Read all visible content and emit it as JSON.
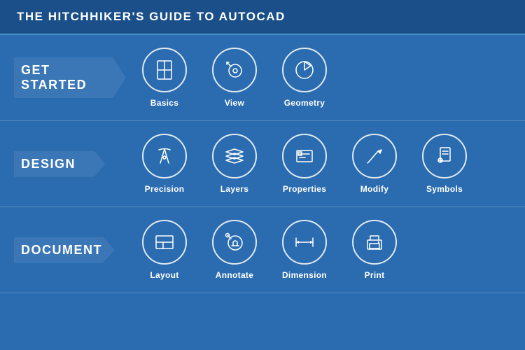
{
  "header": {
    "title": "THE HITCHHIKER'S GUIDE TO AUTOCAD"
  },
  "sections": [
    {
      "id": "get-started",
      "label": "GET STARTED",
      "items": [
        {
          "id": "basics",
          "label": "Basics",
          "icon": "basics"
        },
        {
          "id": "view",
          "label": "View",
          "icon": "view"
        },
        {
          "id": "geometry",
          "label": "Geometry",
          "icon": "geometry"
        }
      ]
    },
    {
      "id": "design",
      "label": "DESIGN",
      "items": [
        {
          "id": "precision",
          "label": "Precision",
          "icon": "precision"
        },
        {
          "id": "layers",
          "label": "Layers",
          "icon": "layers"
        },
        {
          "id": "properties",
          "label": "Properties",
          "icon": "properties"
        },
        {
          "id": "modify",
          "label": "Modify",
          "icon": "modify"
        },
        {
          "id": "symbols",
          "label": "Symbols",
          "icon": "symbols"
        }
      ]
    },
    {
      "id": "document",
      "label": "DOCUMENT",
      "items": [
        {
          "id": "layout",
          "label": "Layout",
          "icon": "layout"
        },
        {
          "id": "annotate",
          "label": "Annotate",
          "icon": "annotate"
        },
        {
          "id": "dimension",
          "label": "Dimension",
          "icon": "dimension"
        },
        {
          "id": "print",
          "label": "Print",
          "icon": "print"
        }
      ]
    }
  ]
}
